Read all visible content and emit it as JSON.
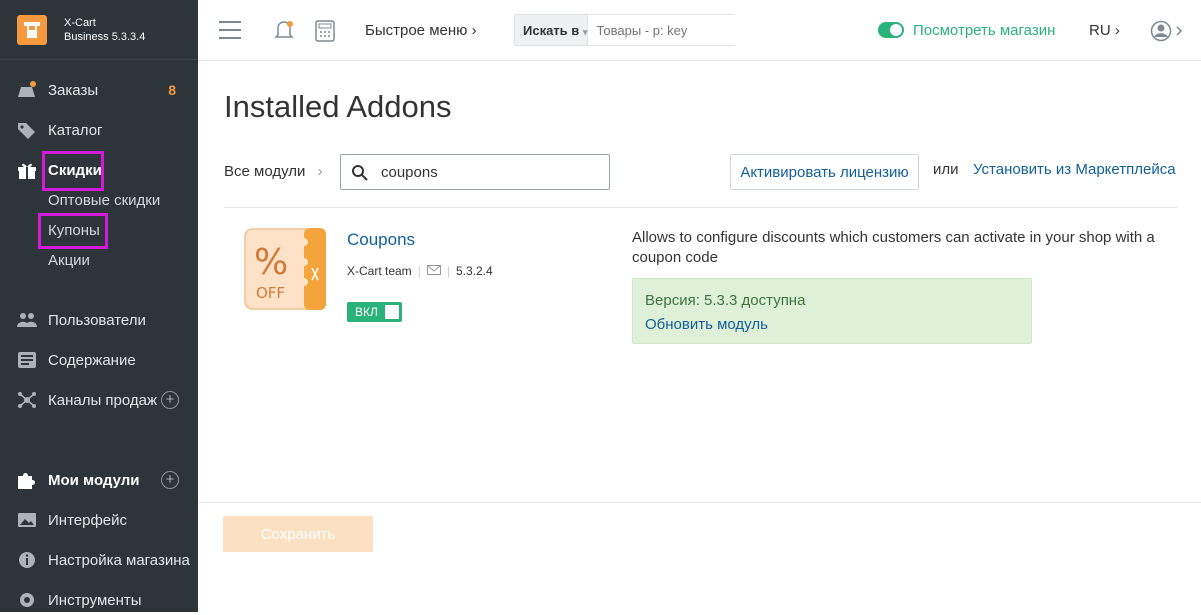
{
  "brand": {
    "name": "X-Cart",
    "edition": "Business 5.3.3.4"
  },
  "sidebar": {
    "orders": {
      "label": "Заказы",
      "badge": "8"
    },
    "catalog": {
      "label": "Каталог"
    },
    "discounts": {
      "label": "Скидки",
      "subitems": [
        "Оптовые скидки",
        "Купоны",
        "Акции"
      ]
    },
    "users": {
      "label": "Пользователи"
    },
    "content": {
      "label": "Содержание"
    },
    "channels": {
      "label": "Каналы продаж"
    },
    "modules": {
      "label": "Мои модули"
    },
    "interface": {
      "label": "Интерфейс"
    },
    "settings": {
      "label": "Настройка магазина"
    },
    "tools": {
      "label": "Инструменты"
    }
  },
  "header": {
    "quick_menu": "Быстрое меню",
    "search_in": "Искать в",
    "search_placeholder": "Товары - p: key",
    "view_store": "Посмотреть магазин",
    "lang": "RU"
  },
  "page": {
    "title": "Installed Addons",
    "breadcrumb": "Все модули",
    "search_value": "coupons",
    "activate_license": "Активировать лицензию",
    "or": "или",
    "install_marketplace": "Установить из Маркетплейса",
    "save": "Сохранить"
  },
  "addon": {
    "name": "Coupons",
    "author": "X-Cart team",
    "version": "5.3.2.4",
    "toggle_label": "ВКЛ",
    "enabled": true,
    "description": "Allows to configure discounts which customers can activate in your shop with a coupon code",
    "update_available": "Версия: 5.3.3 доступна",
    "update_link": "Обновить модуль"
  },
  "colors": {
    "sidebar_bg": "#2d353b",
    "accent_orange": "#f6993f",
    "green": "#2ab27b",
    "link": "#135f9c",
    "highlight": "#d41ad9"
  }
}
